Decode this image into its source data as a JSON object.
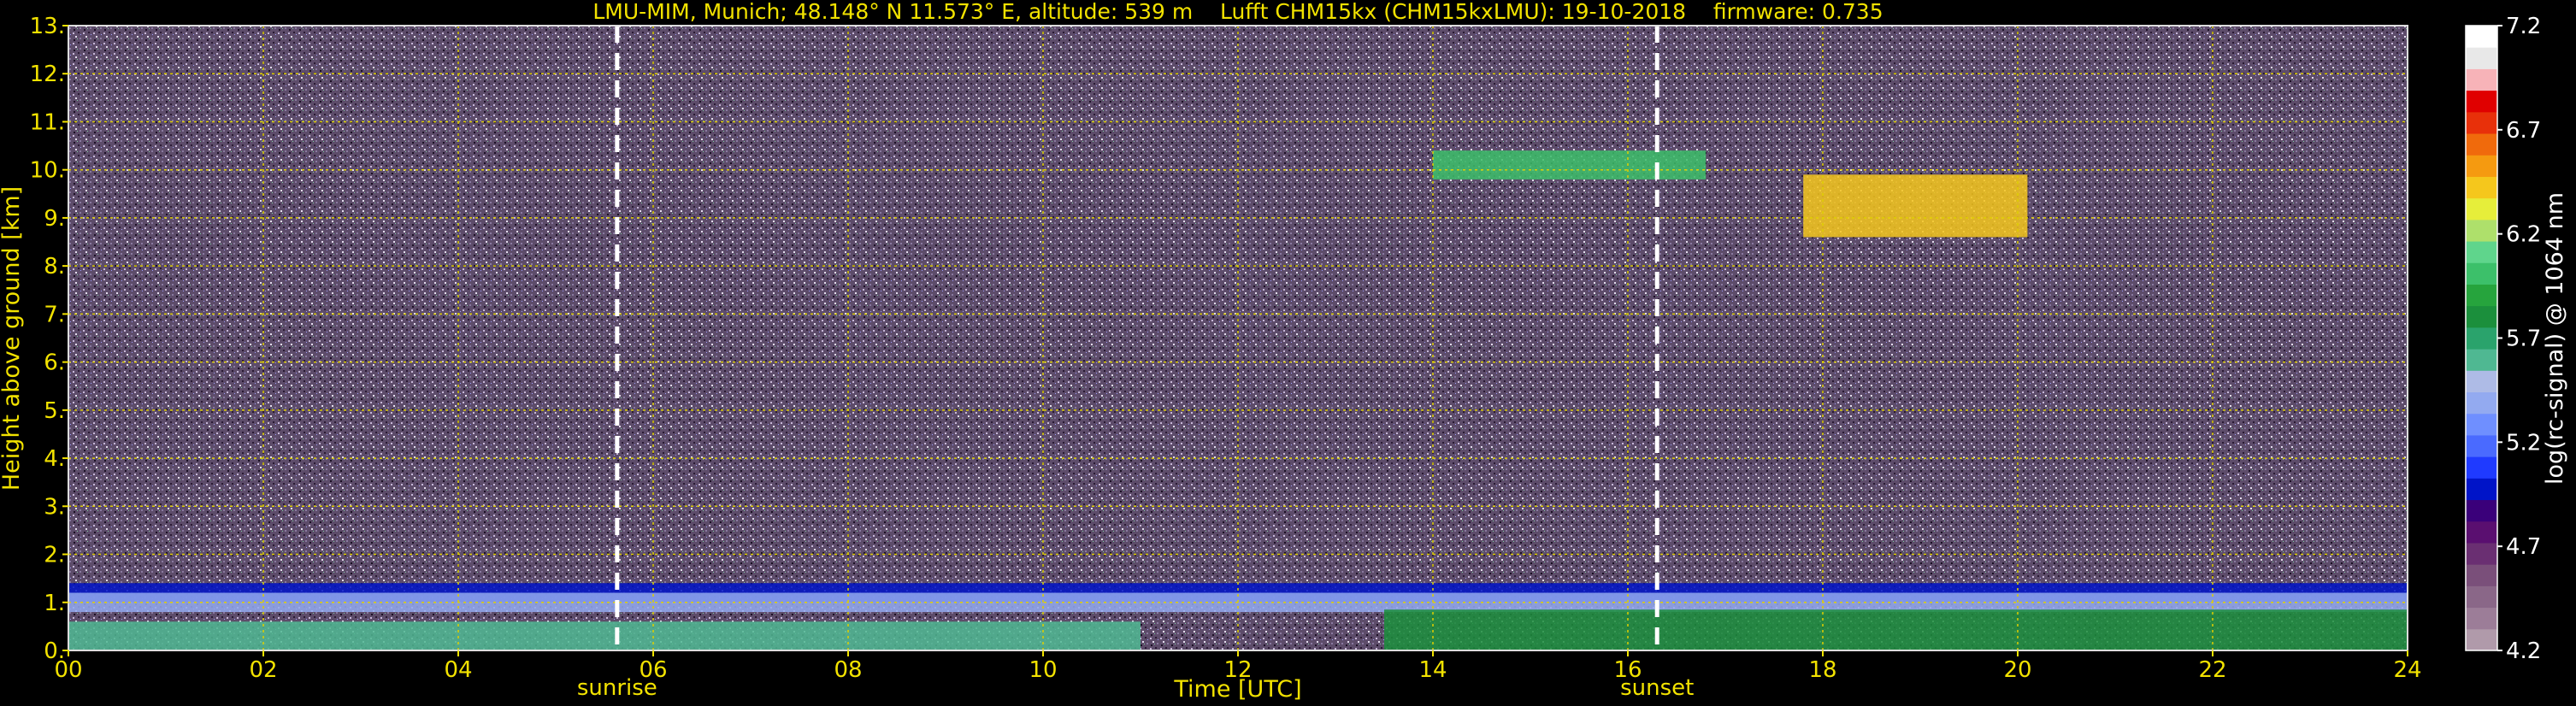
{
  "chart_data": {
    "type": "heatmap",
    "title": "LMU-MIM, Munich; 48.148° N 11.573° E, altitude: 539 m    Lufft CHM15kx (CHM15kxLMU): 19-10-2018    firmware: 0.735",
    "xlabel": "Time [UTC]",
    "ylabel": "Height above ground [km]",
    "xlim": [
      0,
      24
    ],
    "ylim": [
      0,
      13
    ],
    "x_ticks": [
      "00",
      "02",
      "04",
      "06",
      "08",
      "10",
      "12",
      "14",
      "16",
      "18",
      "20",
      "22",
      "24"
    ],
    "y_ticks": [
      "0.",
      "1.",
      "2.",
      "3.",
      "4.",
      "5.",
      "6.",
      "7.",
      "8.",
      "9.",
      "10.",
      "11.",
      "12.",
      "13."
    ],
    "grid": true,
    "colorbar": {
      "label": "log(rc-signal) @ 1064 nm",
      "range": [
        4.2,
        7.2
      ],
      "ticks": [
        "7.2",
        "6.7",
        "6.2",
        "5.7",
        "5.2",
        "4.7",
        "4.2"
      ],
      "colors": [
        "#b09aaa",
        "#9c7d98",
        "#8a6788",
        "#7a4f7a",
        "#6a2f72",
        "#5a0f70",
        "#3a007a",
        "#0014c8",
        "#1f3aff",
        "#4a6aff",
        "#6f8fff",
        "#93aaf0",
        "#aebbe6",
        "#4fb892",
        "#2aa36c",
        "#1b8f3c",
        "#26a43d",
        "#3cc06a",
        "#5fd58c",
        "#aee06b",
        "#e6ee3a",
        "#f5c71c",
        "#f59a10",
        "#f06a0c",
        "#e8300a",
        "#e00000",
        "#f7b3b8",
        "#e8e8e8",
        "#ffffff"
      ]
    },
    "annotations": [
      {
        "text": "sunrise",
        "x": 5.63
      },
      {
        "text": "sunset",
        "x": 16.3
      }
    ],
    "dashed_lines_x": [
      5.63,
      16.3
    ],
    "layers": [
      {
        "name": "aerosol-layer-top",
        "y": [
          1.0,
          1.4
        ],
        "x": [
          0,
          24
        ],
        "value": 5.0
      },
      {
        "name": "aerosol-layer-mid",
        "y": [
          0.8,
          1.2
        ],
        "x": [
          0,
          24
        ],
        "value": 5.4
      },
      {
        "name": "boundary-layer-day",
        "y": [
          0.0,
          0.85
        ],
        "x": [
          13.5,
          24
        ],
        "value": 5.8
      },
      {
        "name": "boundary-layer-morning",
        "y": [
          0.0,
          0.6
        ],
        "x": [
          0,
          11
        ],
        "value": 5.6
      },
      {
        "name": "cirrus-1",
        "x": [
          14.0,
          16.8
        ],
        "y": [
          9.8,
          10.4
        ],
        "value": 6.0
      },
      {
        "name": "cirrus-2",
        "x": [
          17.8,
          20.1
        ],
        "y": [
          8.6,
          9.9
        ],
        "value": 6.4
      }
    ]
  }
}
